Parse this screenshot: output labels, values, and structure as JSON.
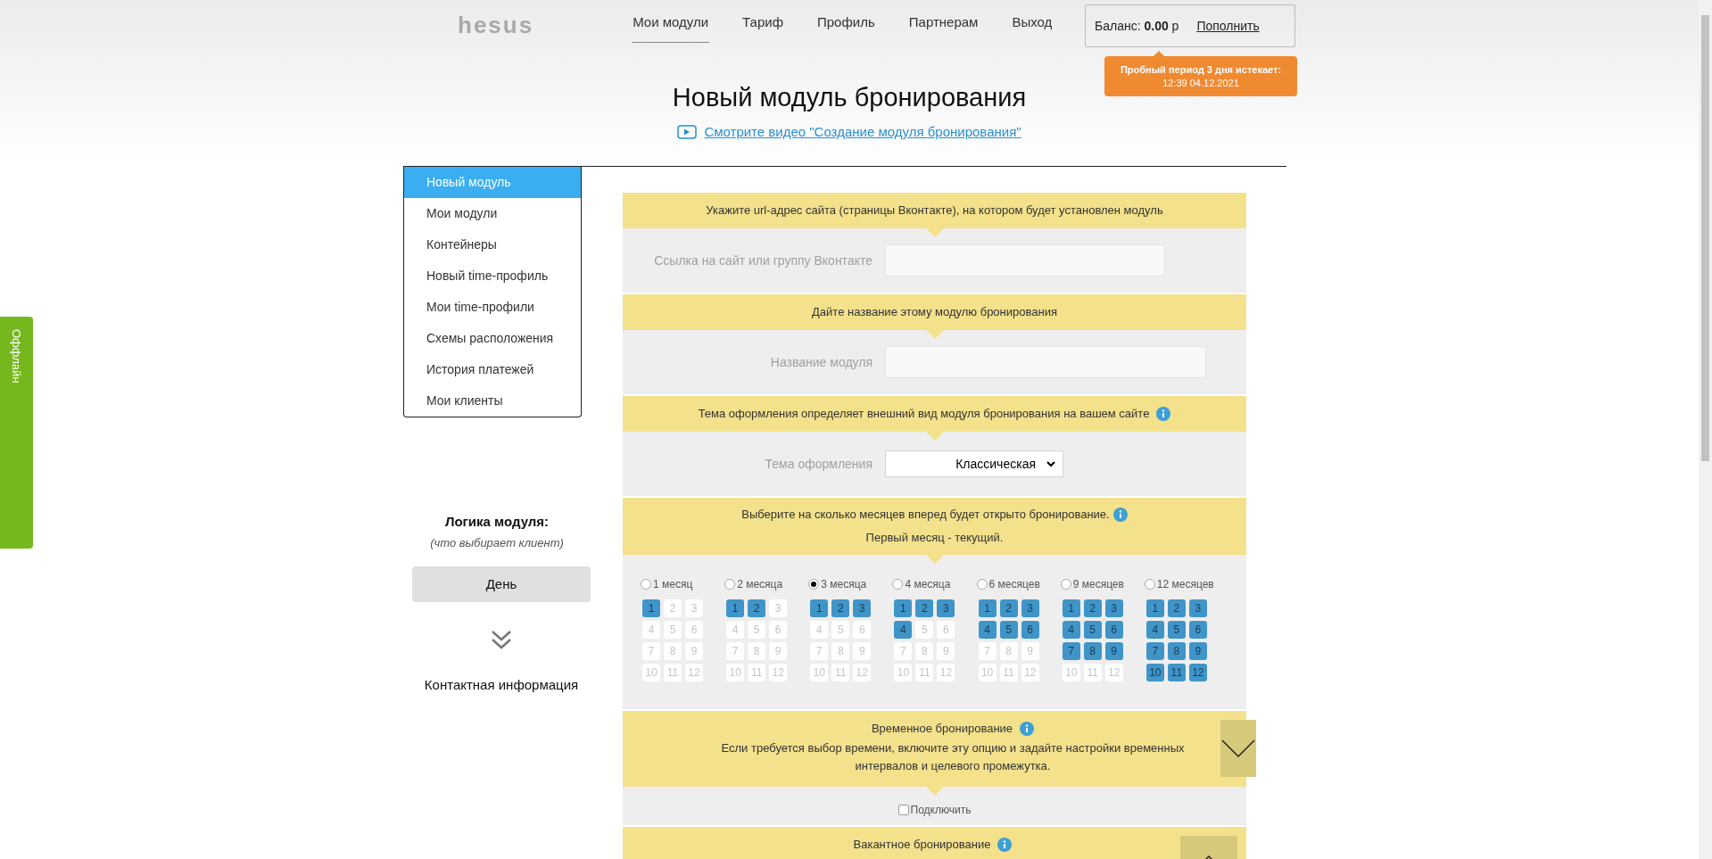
{
  "offline_tab": {
    "label": "Оффлайн"
  },
  "header": {
    "logo": "hesus",
    "nav": [
      {
        "label": "Мои модули",
        "selected": true
      },
      {
        "label": "Тариф",
        "selected": false
      },
      {
        "label": "Профиль",
        "selected": false
      },
      {
        "label": "Партнерам",
        "selected": false
      },
      {
        "label": "Выход",
        "selected": false
      }
    ],
    "balance": {
      "label": "Баланс:",
      "amount": "0.00",
      "currency": "р",
      "topup": "Пополнить"
    },
    "trial": {
      "line1": "Пробный период 3 дня истекает:",
      "line2": "12:39 04.12.2021"
    }
  },
  "title": "Новый модуль бронирования",
  "video_link": "Смотрите видео \"Создание модуля бронирования\"",
  "sidebar": {
    "items": [
      {
        "label": "Новый модуль",
        "selected": true
      },
      {
        "label": "Мои модули",
        "selected": false
      },
      {
        "label": "Контейнеры",
        "selected": false
      },
      {
        "label": "Новый time-профиль",
        "selected": false
      },
      {
        "label": "Мои time-профили",
        "selected": false
      },
      {
        "label": "Схемы расположения",
        "selected": false
      },
      {
        "label": "История платежей",
        "selected": false
      },
      {
        "label": "Мои клиенты",
        "selected": false
      }
    ]
  },
  "logic": {
    "title": "Логика модуля:",
    "subtitle": "(что выбирает клиент)",
    "button": "День",
    "next": "Контактная информация"
  },
  "sections": [
    {
      "kind": "input",
      "header": "Укажите url-адрес сайта (страницы Вконтакте), на котором будет установлен модуль",
      "info": false,
      "label": "Ссылка на сайт или группу Вконтакте",
      "wide": false
    },
    {
      "kind": "input",
      "header": "Дайте название этому модулю бронирования",
      "info": false,
      "label": "Название модуля",
      "wide": true
    },
    {
      "kind": "select",
      "header": "Тема оформления определяет внешний вид модуля бронирования на вашем сайте",
      "info": true,
      "label": "Тема оформления",
      "value": "Классическая"
    },
    {
      "kind": "months",
      "header": "Выберите на сколько месяцев вперед будет открыто бронирование.",
      "info": true,
      "header2": "Первый месяц - текущий.",
      "options": [
        {
          "label": "1 месяц",
          "selected": false,
          "cells": [
            {
              "n": "1",
              "on": true
            },
            {
              "n": "2",
              "on": false
            },
            {
              "n": "3",
              "on": false
            },
            {
              "n": "4",
              "on": false
            },
            {
              "n": "5",
              "on": false
            },
            {
              "n": "6",
              "on": false
            },
            {
              "n": "7",
              "on": false
            },
            {
              "n": "8",
              "on": false
            },
            {
              "n": "9",
              "on": false
            },
            {
              "n": "10",
              "on": false
            },
            {
              "n": "11",
              "on": false
            },
            {
              "n": "12",
              "on": false
            }
          ]
        },
        {
          "label": "2 месяца",
          "selected": false,
          "cells": [
            {
              "n": "1",
              "on": true
            },
            {
              "n": "2",
              "on": true
            },
            {
              "n": "3",
              "on": false
            },
            {
              "n": "4",
              "on": false
            },
            {
              "n": "5",
              "on": false
            },
            {
              "n": "6",
              "on": false
            },
            {
              "n": "7",
              "on": false
            },
            {
              "n": "8",
              "on": false
            },
            {
              "n": "9",
              "on": false
            },
            {
              "n": "10",
              "on": false
            },
            {
              "n": "11",
              "on": false
            },
            {
              "n": "12",
              "on": false
            }
          ]
        },
        {
          "label": "3 месяца",
          "selected": true,
          "cells": [
            {
              "n": "1",
              "on": true
            },
            {
              "n": "2",
              "on": true
            },
            {
              "n": "3",
              "on": true
            },
            {
              "n": "4",
              "on": false
            },
            {
              "n": "5",
              "on": false
            },
            {
              "n": "6",
              "on": false
            },
            {
              "n": "7",
              "on": false
            },
            {
              "n": "8",
              "on": false
            },
            {
              "n": "9",
              "on": false
            },
            {
              "n": "10",
              "on": false
            },
            {
              "n": "11",
              "on": false
            },
            {
              "n": "12",
              "on": false
            }
          ]
        },
        {
          "label": "4 месяца",
          "selected": false,
          "cells": [
            {
              "n": "1",
              "on": true
            },
            {
              "n": "2",
              "on": true
            },
            {
              "n": "3",
              "on": true
            },
            {
              "n": "4",
              "on": true
            },
            {
              "n": "5",
              "on": false
            },
            {
              "n": "6",
              "on": false
            },
            {
              "n": "7",
              "on": false
            },
            {
              "n": "8",
              "on": false
            },
            {
              "n": "9",
              "on": false
            },
            {
              "n": "10",
              "on": false
            },
            {
              "n": "11",
              "on": false
            },
            {
              "n": "12",
              "on": false
            }
          ]
        },
        {
          "label": "6 месяцев",
          "selected": false,
          "cells": [
            {
              "n": "1",
              "on": true
            },
            {
              "n": "2",
              "on": true
            },
            {
              "n": "3",
              "on": true
            },
            {
              "n": "4",
              "on": true
            },
            {
              "n": "5",
              "on": true
            },
            {
              "n": "6",
              "on": true
            },
            {
              "n": "7",
              "on": false
            },
            {
              "n": "8",
              "on": false
            },
            {
              "n": "9",
              "on": false
            },
            {
              "n": "10",
              "on": false
            },
            {
              "n": "11",
              "on": false
            },
            {
              "n": "12",
              "on": false
            }
          ]
        },
        {
          "label": "9 месяцев",
          "selected": false,
          "cells": [
            {
              "n": "1",
              "on": true
            },
            {
              "n": "2",
              "on": true
            },
            {
              "n": "3",
              "on": true
            },
            {
              "n": "4",
              "on": true
            },
            {
              "n": "5",
              "on": true
            },
            {
              "n": "6",
              "on": true
            },
            {
              "n": "7",
              "on": true
            },
            {
              "n": "8",
              "on": true
            },
            {
              "n": "9",
              "on": true
            },
            {
              "n": "10",
              "on": false
            },
            {
              "n": "11",
              "on": false
            },
            {
              "n": "12",
              "on": false
            }
          ]
        },
        {
          "label": "12 месяцев",
          "selected": false,
          "cells": [
            {
              "n": "1",
              "on": true
            },
            {
              "n": "2",
              "on": true
            },
            {
              "n": "3",
              "on": true
            },
            {
              "n": "4",
              "on": true
            },
            {
              "n": "5",
              "on": true
            },
            {
              "n": "6",
              "on": true
            },
            {
              "n": "7",
              "on": true
            },
            {
              "n": "8",
              "on": true
            },
            {
              "n": "9",
              "on": true
            },
            {
              "n": "10",
              "on": true
            },
            {
              "n": "11",
              "on": true
            },
            {
              "n": "12",
              "on": true
            }
          ]
        }
      ]
    },
    {
      "kind": "toggle",
      "header": "Временное бронирование",
      "info": true,
      "description": "Если требуется выбор времени, включите эту опцию и задайте настройки временных интервалов и целевого промежутка.",
      "expanded": false,
      "checkbox": {
        "label": "Подключить",
        "checked": false
      }
    },
    {
      "kind": "toggle",
      "header": "Вакантное бронирование",
      "info": true,
      "expanded": true
    }
  ]
}
